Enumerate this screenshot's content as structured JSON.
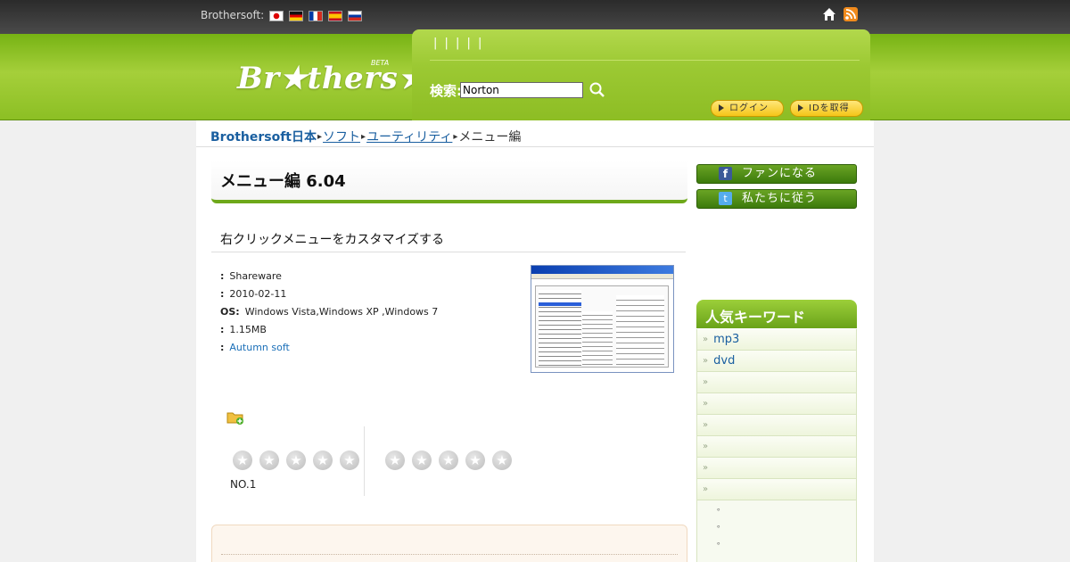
{
  "topbar": {
    "brand_label": "Brothersoft:",
    "flags": [
      "flag-jp-icon",
      "flag-de-icon",
      "flag-fr-icon",
      "flag-es-icon",
      "flag-ru-icon"
    ],
    "icons": [
      "home-icon",
      "rss-icon"
    ]
  },
  "header": {
    "logo_text": "Br★thers★ft",
    "logo_beta": "BETA",
    "panel_tabs": "| | | | |",
    "search_label": "検索:",
    "search_value": "Norton",
    "login_label": "ログイン",
    "register_label": "IDを取得"
  },
  "breadcrumb": {
    "home": "Brothersoft日本",
    "items": [
      "ソフト",
      "ユーティリティ"
    ],
    "current": "メニュー編"
  },
  "app": {
    "title": "メニュー編 6.04",
    "subtitle": "右クリックメニューをカスタマイズする",
    "license_value": "Shareware",
    "date_value": "2010-02-11",
    "os_label": "OS:",
    "os_value": "Windows Vista,Windows XP ,Windows 7",
    "size_value": "1.15MB",
    "author_value": "Autumn soft",
    "rank": "NO.1"
  },
  "sidebar": {
    "fb_label": "ファンになる",
    "tw_label": "私たちに従う",
    "heading": "人気キーワード",
    "items": [
      "mp3",
      "dvd",
      "",
      "",
      "",
      "",
      "",
      ""
    ],
    "sub_items": [
      "。",
      "。",
      "。"
    ]
  },
  "colors": {
    "header_green": "#8cbf24",
    "link_blue": "#1a5fa0",
    "accent_green": "#6ea81a"
  }
}
